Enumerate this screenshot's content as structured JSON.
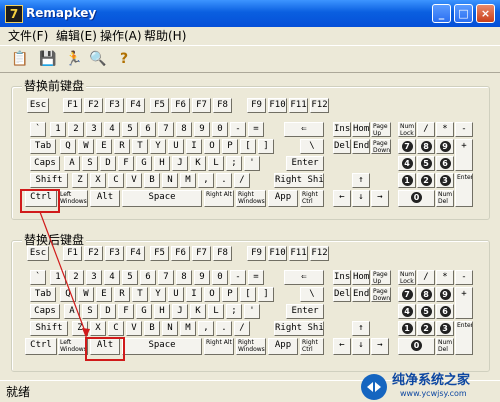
{
  "window": {
    "title": "Remapkey",
    "icon_glyph": "7",
    "min_label": "_",
    "max_label": "□",
    "close_label": "×"
  },
  "menu": [
    "文件(F)",
    "编辑(E)",
    "操作(A)",
    "帮助(H)"
  ],
  "toolbar_icons": [
    "open-icon",
    "restore-icon",
    "run-icon",
    "view-icon",
    "help-icon"
  ],
  "toolbar_glyphs": [
    "📋",
    "💾",
    "🏃",
    "🔍",
    "?"
  ],
  "groups": {
    "top": "替换前键盘",
    "bottom": "替换后键盘"
  },
  "status": "就绪",
  "accent_color": "#d01a1a",
  "keyboard": {
    "fn": [
      "Esc",
      "F1",
      "F2",
      "F3",
      "F4",
      "F5",
      "F6",
      "F7",
      "F8",
      "F9",
      "F10",
      "F11",
      "F12"
    ],
    "row1": [
      "`",
      "1",
      "2",
      "3",
      "4",
      "5",
      "6",
      "7",
      "8",
      "9",
      "0",
      "-",
      "=",
      "⇐"
    ],
    "row2": [
      "Tab",
      "Q",
      "W",
      "E",
      "R",
      "T",
      "Y",
      "U",
      "I",
      "O",
      "P",
      "[",
      "]",
      "\\"
    ],
    "row3": [
      "Caps",
      "A",
      "S",
      "D",
      "F",
      "G",
      "H",
      "J",
      "K",
      "L",
      ";",
      "'",
      "Enter"
    ],
    "row4": [
      "Shift",
      "Z",
      "X",
      "C",
      "V",
      "B",
      "N",
      "M",
      ",",
      ".",
      "/",
      "Right Shift"
    ],
    "row5": [
      "Ctrl",
      "Left Windows",
      "Alt",
      "Space",
      "Right Alt",
      "Right Windows",
      "App",
      "Right Ctrl"
    ],
    "nav1": [
      "Ins",
      "Home",
      "Page Up"
    ],
    "nav2": [
      "Del",
      "End",
      "Page Down"
    ],
    "arrows": [
      "↑",
      "←",
      "↓",
      "→"
    ],
    "num1": [
      "Num Lock",
      "/",
      "*",
      "-"
    ],
    "num2": [
      "7",
      "8",
      "9",
      "+"
    ],
    "num3": [
      "4",
      "5",
      "6"
    ],
    "num4": [
      "1",
      "2",
      "3",
      "Enter"
    ],
    "num5": [
      "0",
      "Num Del"
    ]
  },
  "watermark": {
    "title": "纯净系统之家",
    "url": "www.ycwjsy.com"
  }
}
